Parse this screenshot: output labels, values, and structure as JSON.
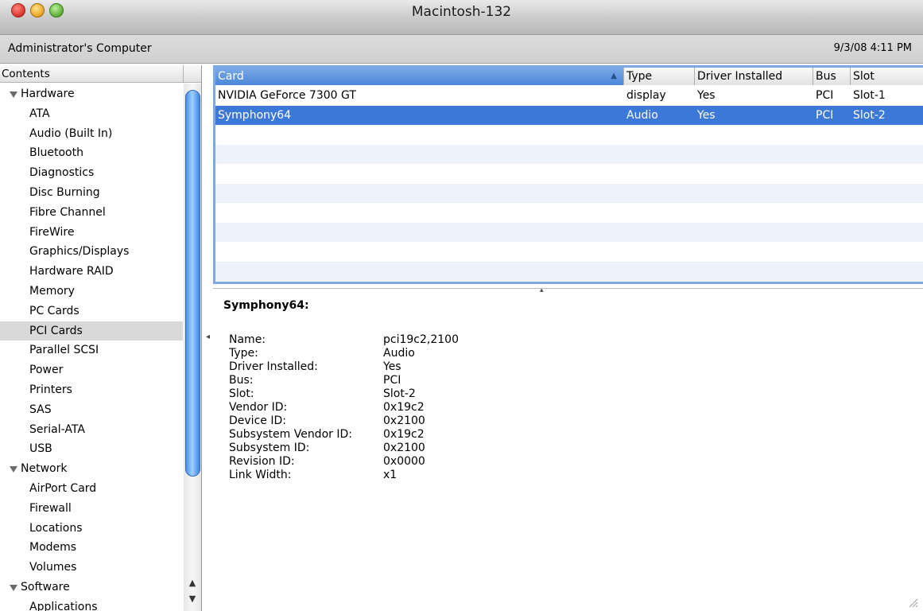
{
  "window": {
    "title": "Macintosh-132"
  },
  "infobar": {
    "computer_name": "Administrator's Computer",
    "datetime": "9/3/08 4:11 PM"
  },
  "sidebar": {
    "header": "Contents",
    "groups": [
      {
        "label": "Hardware"
      },
      {
        "label": "Network"
      },
      {
        "label": "Software"
      }
    ],
    "hardware_items": [
      "ATA",
      "Audio (Built In)",
      "Bluetooth",
      "Diagnostics",
      "Disc Burning",
      "Fibre Channel",
      "FireWire",
      "Graphics/Displays",
      "Hardware RAID",
      "Memory",
      "PC Cards",
      "PCI Cards",
      "Parallel SCSI",
      "Power",
      "Printers",
      "SAS",
      "Serial-ATA",
      "USB"
    ],
    "network_items": [
      "AirPort Card",
      "Firewall",
      "Locations",
      "Modems",
      "Volumes"
    ],
    "software_items": [
      "Applications"
    ],
    "selected": "PCI Cards"
  },
  "table": {
    "columns": [
      "Card",
      "Type",
      "Driver Installed",
      "Bus",
      "Slot"
    ],
    "sort_indicator": "▲",
    "rows": [
      {
        "card": "NVIDIA GeForce 7300 GT",
        "type": "display",
        "driver": "Yes",
        "bus": "PCI",
        "slot": "Slot-1"
      },
      {
        "card": "Symphony64",
        "type": "Audio",
        "driver": "Yes",
        "bus": "PCI",
        "slot": "Slot-2"
      }
    ],
    "selected_row": 1
  },
  "detail": {
    "title": "Symphony64:",
    "fields": [
      {
        "key": "Name:",
        "value": "pci19c2,2100"
      },
      {
        "key": "Type:",
        "value": "Audio"
      },
      {
        "key": "Driver Installed:",
        "value": "Yes"
      },
      {
        "key": "Bus:",
        "value": "PCI"
      },
      {
        "key": "Slot:",
        "value": "Slot-2"
      },
      {
        "key": "Vendor ID:",
        "value": "0x19c2"
      },
      {
        "key": "Device ID:",
        "value": "0x2100"
      },
      {
        "key": "Subsystem Vendor ID:",
        "value": "0x19c2"
      },
      {
        "key": "Subsystem ID:",
        "value": "0x2100"
      },
      {
        "key": "Revision ID:",
        "value": "0x0000"
      },
      {
        "key": "Link Width:",
        "value": "x1"
      }
    ]
  },
  "colors": {
    "selection": "#3c78d8",
    "sidebar_selection": "#d9d9d9",
    "scroll_thumb": "#4b8fe6"
  },
  "icons": {
    "disclosure": "triangle-down-icon",
    "scroll_up": "arrow-up-icon",
    "scroll_down": "arrow-down-icon"
  }
}
